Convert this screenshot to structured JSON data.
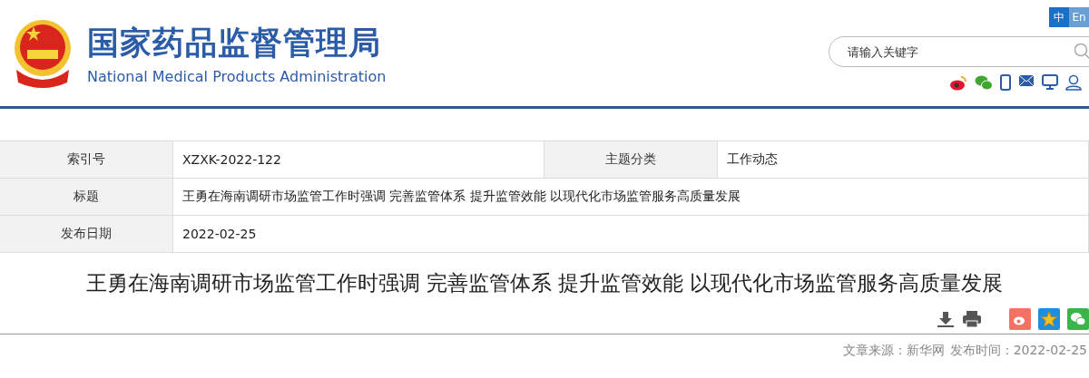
{
  "header": {
    "title": "国家药品监督管理局",
    "subtitle": "National Medical Products Administration"
  },
  "languages": [
    {
      "label": "中",
      "selected": true
    },
    {
      "label": "En",
      "selected": false
    }
  ],
  "search": {
    "placeholder": "请输入关键字"
  },
  "info_table": {
    "rows": [
      [
        {
          "label": "索引号",
          "value": "XZXK-2022-122"
        },
        {
          "label": "主题分类",
          "value": "工作动态"
        }
      ],
      [
        {
          "label": "标题",
          "value": "王勇在海南调研市场监管工作时强调 完善监管体系 提升监管效能 以现代化市场监管服务高质量发展"
        }
      ],
      [
        {
          "label": "发布日期",
          "value": "2022-02-25"
        }
      ]
    ]
  },
  "article": {
    "title": "王勇在海南调研市场监管工作时强调 完善监管体系 提升监管效能 以现代化市场监管服务高质量发展",
    "source": "文章来源：新华网",
    "published": "发布时间：2022-02-25"
  }
}
